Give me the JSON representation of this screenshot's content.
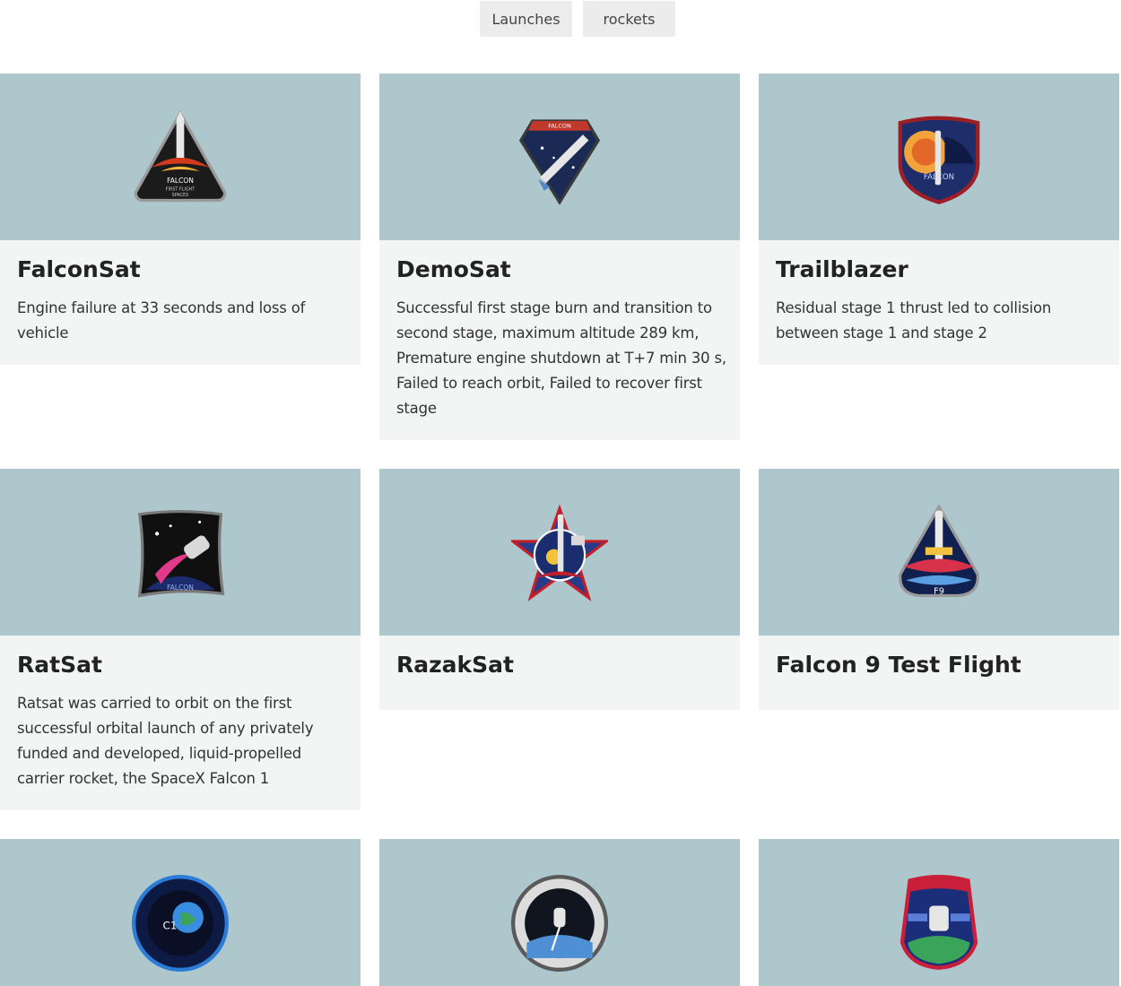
{
  "nav": {
    "launches_label": "Launches",
    "rockets_label": "rockets"
  },
  "colors": {
    "banner": "#adc7cd",
    "card_body": "#f3f4f4",
    "nav_button": "#ececec"
  },
  "launches": [
    {
      "name": "FalconSat",
      "details": "Engine failure at 33 seconds and loss of vehicle",
      "patch_icon": "falconsat-mission-patch-icon"
    },
    {
      "name": "DemoSat",
      "details": "Successful first stage burn and transition to second stage, maximum altitude 289 km, Premature engine shutdown at T+7 min 30 s, Failed to reach orbit, Failed to recover first stage",
      "patch_icon": "demosat-mission-patch-icon"
    },
    {
      "name": "Trailblazer",
      "details": "Residual stage 1 thrust led to collision between stage 1 and stage 2",
      "patch_icon": "trailblazer-mission-patch-icon"
    },
    {
      "name": "RatSat",
      "details": "Ratsat was carried to orbit on the first successful orbital launch of any privately funded and developed, liquid-propelled carrier rocket, the SpaceX Falcon 1",
      "patch_icon": "ratsat-mission-patch-icon"
    },
    {
      "name": "RazakSat",
      "details": "",
      "patch_icon": "razaksat-mission-patch-icon"
    },
    {
      "name": "Falcon 9 Test Flight",
      "details": "",
      "patch_icon": "falcon9-test-flight-mission-patch-icon"
    },
    {
      "name": "",
      "details": "",
      "patch_icon": "cots1-mission-patch-icon"
    },
    {
      "name": "",
      "details": "",
      "patch_icon": "cots2-mission-patch-icon"
    },
    {
      "name": "",
      "details": "",
      "patch_icon": "crs1-mission-patch-icon"
    }
  ]
}
